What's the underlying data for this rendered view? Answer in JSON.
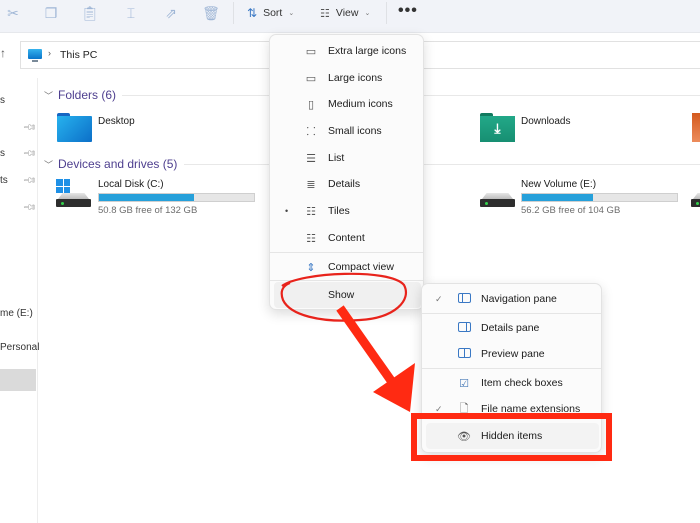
{
  "toolbar": {
    "icons": [
      "cut-icon",
      "copy-icon",
      "paste-icon",
      "rename-icon",
      "share-icon",
      "delete-icon"
    ],
    "sort_label": "Sort",
    "view_label": "View",
    "more_label": "•••"
  },
  "address": {
    "path": "This PC"
  },
  "sidebar": {
    "items": [
      {
        "label": "s",
        "pinned": false
      },
      {
        "label": "",
        "pinned": true
      },
      {
        "label": "s",
        "pinned": true
      },
      {
        "label": "ts",
        "pinned": true
      },
      {
        "label": "",
        "pinned": true
      },
      {
        "label": "me (E:)",
        "pinned": false
      },
      {
        "label": "Personal",
        "pinned": false
      },
      {
        "label": "",
        "selected": true
      }
    ]
  },
  "content": {
    "folders_header": "Folders (6)",
    "folders": [
      {
        "name": "Desktop",
        "color": "#1f9ae6"
      },
      {
        "name": "Downloads",
        "color": "#1ea081"
      }
    ],
    "drives_header": "Devices and drives (5)",
    "drives": [
      {
        "name": "Local Disk (C:)",
        "free": "50.8 GB free of 132 GB",
        "used_fraction": 0.615
      },
      {
        "name": "New Volume (E:)",
        "free": "56.2 GB free of 104 GB",
        "used_fraction": 0.46
      }
    ]
  },
  "view_menu": {
    "items": [
      {
        "label": "Extra large icons",
        "icon": "monitor-icon"
      },
      {
        "label": "Large icons",
        "icon": "monitor-icon"
      },
      {
        "label": "Medium icons",
        "icon": "monitor-icon"
      },
      {
        "label": "Small icons",
        "icon": "grid-icon"
      },
      {
        "label": "List",
        "icon": "list-icon"
      },
      {
        "label": "Details",
        "icon": "details-icon"
      },
      {
        "label": "Tiles",
        "icon": "tiles-icon",
        "selected": true
      },
      {
        "label": "Content",
        "icon": "content-icon"
      },
      {
        "label": "Compact view",
        "icon": "compact-icon"
      },
      {
        "label": "Show",
        "icon": ""
      }
    ],
    "selected_bullet": "•"
  },
  "show_submenu": {
    "items": [
      {
        "label": "Navigation pane",
        "checked": true
      },
      {
        "label": "Details pane",
        "checked": false
      },
      {
        "label": "Preview pane",
        "checked": false
      },
      {
        "label": "Item check boxes",
        "checked": false
      },
      {
        "label": "File name extensions",
        "checked": true
      },
      {
        "label": "Hidden items",
        "checked": false
      }
    ],
    "check_glyph": "✓"
  },
  "annotations": {
    "color": "#ff2a12",
    "highlighted_item": "Hidden items",
    "circled_item": "Show"
  }
}
